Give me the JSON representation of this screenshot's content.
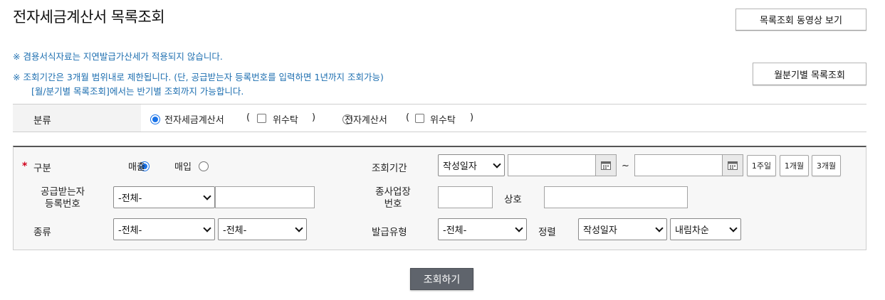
{
  "header": {
    "title": "전자세금계산서 목록조회",
    "video_button": "목록조회 동영상 보기",
    "monthly_button": "월분기별 목록조회"
  },
  "notices": [
    "※ 겸용서식자료는 지연발급가산세가 적용되지 않습니다.",
    "※ 조회기간은 3개월 범위내로 제한됩니다. (단, 공급받는자 등록번호를 입력하면 1년까지 조회가능)",
    "[월/분기별 목록조회]에서는 반기별 조회까지 가능합니다."
  ],
  "category": {
    "label": "분류",
    "option1": "전자세금계산서",
    "option2": "전자계산서",
    "paren_open": "(",
    "paren_close": ")",
    "trust_label": "위수탁"
  },
  "form": {
    "required_mark": "*",
    "division_label": "구분",
    "sales_label": "매출",
    "purchase_label": "매입",
    "period_label": "조회기간",
    "period_type": "작성일자",
    "tilde": "~",
    "date_from": "",
    "date_to": "",
    "week_button": "1주일",
    "month_button": "1개월",
    "three_month_button": "3개월",
    "supplier_label_line1": "공급받는자",
    "supplier_label_line2": "등록번호",
    "supplier_select": "-전체-",
    "supplier_input": "",
    "branch_label_line1": "종사업장",
    "branch_label_line2": "번호",
    "branch_input": "",
    "company_label": "상호",
    "company_input": "",
    "kind_label": "종류",
    "kind_select1": "-전체-",
    "kind_select2": "-전체-",
    "issue_type_label": "발급유형",
    "issue_type_select": "-전체-",
    "sort_label": "정렬",
    "sort_field": "작성일자",
    "sort_order": "내림차순"
  },
  "submit_label": "조회하기",
  "colors": {
    "notice_text": "#1e6fb0",
    "required_mark": "#d0021b",
    "submit_bg": "#5f646c",
    "radio_selected": "#1a73e8"
  }
}
